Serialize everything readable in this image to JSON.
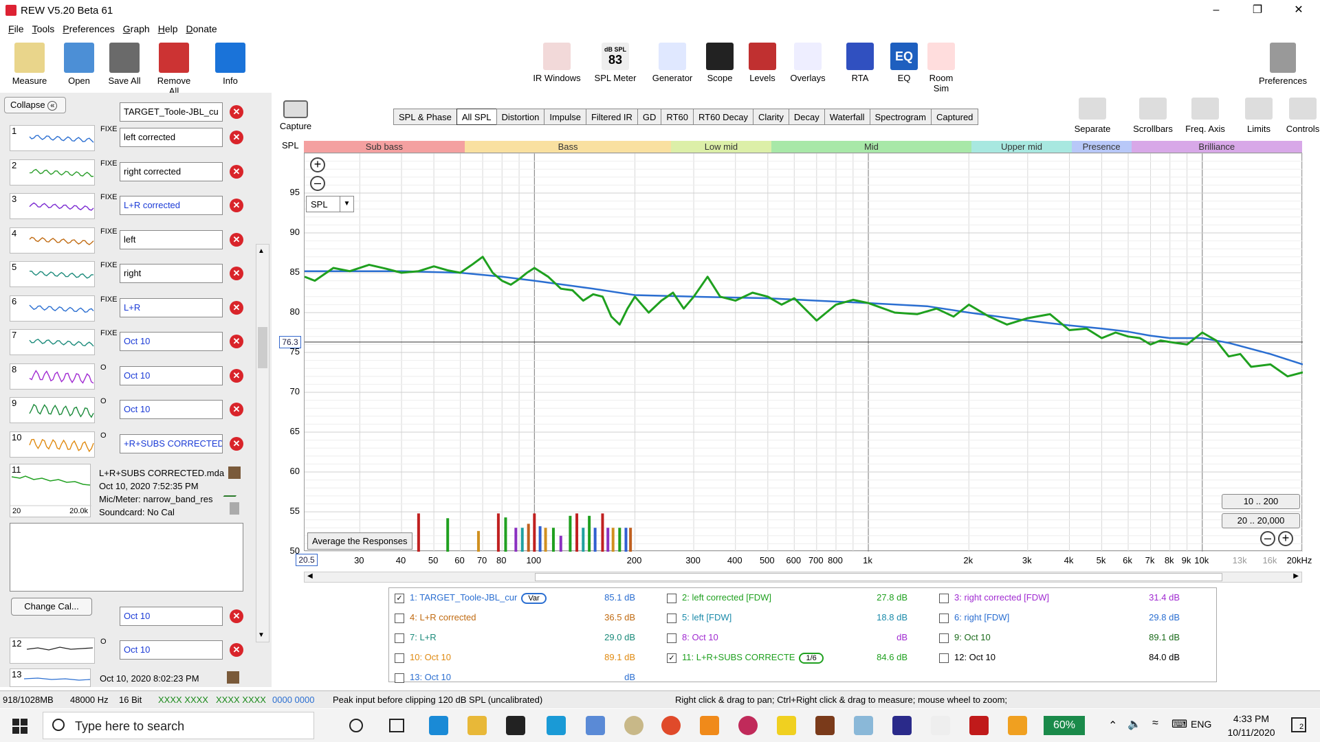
{
  "window": {
    "title": "REW V5.20 Beta 61"
  },
  "menu": [
    "File",
    "Tools",
    "Preferences",
    "Graph",
    "Help",
    "Donate"
  ],
  "toolbar_left": [
    {
      "label": "Measure",
      "color": "#e9d58b",
      "icon": "measure-icon"
    },
    {
      "label": "Open",
      "color": "#4c8fd6",
      "icon": "folder-open-icon"
    },
    {
      "label": "Save All",
      "color": "#6a6a6a",
      "icon": "save-icon"
    },
    {
      "label": "Remove All",
      "color": "#c33",
      "icon": "remove-all-icon"
    },
    {
      "label": "Info",
      "color": "#1a73d9",
      "icon": "info-icon"
    }
  ],
  "toolbar_mid": [
    {
      "label": "IR Windows",
      "color": "#f2d9d9",
      "icon": "ir-windows-icon"
    },
    {
      "label": "SPL Meter",
      "color": "#eee",
      "icon": "spl-meter-icon",
      "value": "83",
      "sub": "dB SPL"
    },
    {
      "label": "Generator",
      "color": "#e0e8ff",
      "icon": "generator-icon"
    },
    {
      "label": "Scope",
      "color": "#222",
      "icon": "scope-icon"
    },
    {
      "label": "Levels",
      "color": "#c03030",
      "icon": "levels-icon"
    },
    {
      "label": "Overlays",
      "color": "#eef",
      "icon": "overlays-icon"
    },
    {
      "label": "RTA",
      "color": "#3050c0",
      "icon": "rta-icon"
    },
    {
      "label": "EQ",
      "color": "#1e5fbf",
      "icon": "eq-icon",
      "value": "EQ"
    },
    {
      "label": "Room Sim",
      "color": "#fdd",
      "icon": "room-sim-icon"
    }
  ],
  "toolbar_right": {
    "label": "Preferences",
    "icon": "preferences-icon"
  },
  "left_panel": {
    "collapse": "Collapse",
    "top_field": "TARGET_Toole-JBL_cu",
    "fix_label": "FIXE",
    "measurements": [
      {
        "num": "1",
        "name": "left corrected",
        "color": "#2a6ed1",
        "fix": "FIXE"
      },
      {
        "num": "2",
        "name": "right corrected",
        "color": "#2a9d2a",
        "fix": "FIXE"
      },
      {
        "num": "3",
        "name": "L+R corrected",
        "color": "#7a2ad1",
        "fix": "FIXE"
      },
      {
        "num": "4",
        "name": "left",
        "color": "#c06a10",
        "fix": "FIXE"
      },
      {
        "num": "5",
        "name": "right",
        "color": "#1a8a7a",
        "fix": "FIXE"
      },
      {
        "num": "6",
        "name": "L+R",
        "color": "#2a6ed1",
        "fix": "FIXE"
      },
      {
        "num": "7",
        "name": "Oct 10",
        "color": "#1a8a7a",
        "fix": "FIXE"
      },
      {
        "num": "8",
        "name": "Oct 10",
        "color": "#a02ad1",
        "fix": "O"
      },
      {
        "num": "9",
        "name": "Oct 10",
        "color": "#1a8a3a",
        "fix": "O"
      },
      {
        "num": "10",
        "name": "+R+SUBS CORRECTED",
        "color": "#e08a10",
        "fix": "O"
      }
    ],
    "info": {
      "num": "11",
      "file": "L+R+SUBS CORRECTED.mda",
      "date": "Oct 10, 2020 7:52:35 PM",
      "mic": "Mic/Meter: narrow_band_res",
      "soundcard": "Soundcard: No Cal",
      "xmin": "20",
      "xmax": "20.0k"
    },
    "change_cal": "Change Cal...",
    "lower": [
      {
        "num": "",
        "name": "Oct 10"
      },
      {
        "num": "12",
        "name": "Oct 10",
        "fix": "O"
      }
    ],
    "last": {
      "num": "13",
      "date": "Oct 10, 2020 8:02:23 PM"
    }
  },
  "capture": "Capture",
  "graph_tabs": [
    "SPL & Phase",
    "All SPL",
    "Distortion",
    "Impulse",
    "Filtered IR",
    "GD",
    "RT60",
    "RT60 Decay",
    "Clarity",
    "Decay",
    "Waterfall",
    "Spectrogram",
    "Captured"
  ],
  "active_tab": "All SPL",
  "right_tools": [
    {
      "label": "Separate",
      "icon": "separate-icon"
    },
    {
      "label": "Scrollbars",
      "icon": "scrollbars-icon"
    },
    {
      "label": "Freq. Axis",
      "icon": "freq-axis-icon"
    },
    {
      "label": "Limits",
      "icon": "limits-icon"
    },
    {
      "label": "Controls",
      "icon": "controls-icon"
    }
  ],
  "bands": [
    {
      "name": "Sub bass",
      "color": "#f4a0a0",
      "w": 0.161
    },
    {
      "name": "Bass",
      "color": "#f9e0a0",
      "w": 0.207
    },
    {
      "name": "Low mid",
      "color": "#dcefa8",
      "w": 0.1
    },
    {
      "name": "Mid",
      "color": "#a8e8a8",
      "w": 0.201
    },
    {
      "name": "Upper mid",
      "color": "#a8e8e0",
      "w": 0.1
    },
    {
      "name": "Presence",
      "color": "#b8c8f8",
      "w": 0.06
    },
    {
      "name": "Brilliance",
      "color": "#d8a8e8",
      "w": 0.171
    }
  ],
  "plot": {
    "ylabel": "SPL",
    "mode": "SPL",
    "cursor_value": "76.3",
    "x_start": "20.5",
    "average_button": "Average the Responses",
    "range1": "10 .. 200",
    "range2": "20 .. 20,000"
  },
  "chart_data": {
    "type": "line",
    "xlabel": "",
    "ylabel": "SPL",
    "x_scale": "log",
    "xlim": [
      20.5,
      20000
    ],
    "ylim": [
      50,
      100
    ],
    "yticks": [
      50,
      55,
      60,
      65,
      70,
      75,
      80,
      85,
      90,
      95
    ],
    "xticks": [
      {
        "v": 30,
        "t": "30"
      },
      {
        "v": 40,
        "t": "40"
      },
      {
        "v": 50,
        "t": "50"
      },
      {
        "v": 60,
        "t": "60"
      },
      {
        "v": 70,
        "t": "70"
      },
      {
        "v": 80,
        "t": "80"
      },
      {
        "v": 100,
        "t": "100"
      },
      {
        "v": 200,
        "t": "200"
      },
      {
        "v": 300,
        "t": "300"
      },
      {
        "v": 400,
        "t": "400"
      },
      {
        "v": 500,
        "t": "500"
      },
      {
        "v": 600,
        "t": "600"
      },
      {
        "v": 700,
        "t": "700"
      },
      {
        "v": 800,
        "t": "800"
      },
      {
        "v": 1000,
        "t": "1k"
      },
      {
        "v": 2000,
        "t": "2k"
      },
      {
        "v": 3000,
        "t": "3k"
      },
      {
        "v": 4000,
        "t": "4k"
      },
      {
        "v": 5000,
        "t": "5k"
      },
      {
        "v": 6000,
        "t": "6k"
      },
      {
        "v": 7000,
        "t": "7k"
      },
      {
        "v": 8000,
        "t": "8k"
      },
      {
        "v": 9000,
        "t": "9k"
      },
      {
        "v": 10000,
        "t": "10k"
      },
      {
        "v": 13000,
        "t": "13k"
      },
      {
        "v": 16000,
        "t": "16k"
      },
      {
        "v": 20000,
        "t": "20kHz"
      }
    ],
    "series": [
      {
        "name": "TARGET_Toole-JBL_cur",
        "color": "#2a6ed1",
        "x": [
          20.5,
          40,
          60,
          80,
          100,
          150,
          200,
          300,
          500,
          700,
          1000,
          1500,
          2000,
          3000,
          4000,
          5000,
          6000,
          7000,
          8000,
          10000,
          12000,
          16000,
          20000
        ],
        "y": [
          85.2,
          85.2,
          85.0,
          84.5,
          84,
          83,
          82.2,
          82,
          81.8,
          81.5,
          81.2,
          80.8,
          80,
          79,
          78.4,
          78,
          77.6,
          77.1,
          76.8,
          76.8,
          76.2,
          74.8,
          73.5
        ]
      },
      {
        "name": "11: L+R+SUBS CORRECTE",
        "color": "#1fa01f",
        "x": [
          20.5,
          22,
          25,
          28,
          32,
          36,
          40,
          45,
          50,
          55,
          60,
          65,
          70,
          75,
          80,
          85,
          90,
          95,
          100,
          110,
          120,
          130,
          140,
          150,
          160,
          170,
          180,
          190,
          200,
          220,
          240,
          260,
          280,
          300,
          330,
          360,
          400,
          450,
          500,
          550,
          600,
          700,
          800,
          900,
          1000,
          1200,
          1400,
          1600,
          1800,
          2000,
          2300,
          2600,
          3000,
          3500,
          4000,
          4500,
          5000,
          5500,
          6000,
          6500,
          7000,
          7500,
          8000,
          9000,
          10000,
          11000,
          12000,
          13000,
          14000,
          16000,
          18000,
          20000
        ],
        "y": [
          84.5,
          84,
          85.6,
          85.2,
          86,
          85.5,
          85,
          85.2,
          85.8,
          85.3,
          85,
          86,
          87,
          85,
          84,
          83.5,
          84.2,
          85,
          85.6,
          84.5,
          83,
          82.8,
          81.5,
          82.3,
          82,
          79.5,
          78.5,
          80.5,
          82,
          80,
          81.5,
          82.5,
          80.5,
          82,
          84.5,
          82,
          81.5,
          82.5,
          82,
          81,
          81.8,
          79,
          81,
          81.6,
          81.2,
          80,
          79.8,
          80.5,
          79.5,
          81,
          79.5,
          78.5,
          79.3,
          79.8,
          77.8,
          78,
          76.8,
          77.5,
          77,
          76.8,
          76,
          76.5,
          76.3,
          76,
          77.5,
          76.5,
          74.5,
          74.8,
          73.2,
          73.5,
          72,
          72.5
        ]
      }
    ],
    "bars": [
      {
        "x": 45,
        "y": 54.8,
        "c": "#c02020"
      },
      {
        "x": 55,
        "y": 54.2,
        "c": "#20a020"
      },
      {
        "x": 68,
        "y": 52.6,
        "c": "#d09020"
      },
      {
        "x": 78,
        "y": 54.8,
        "c": "#c02020"
      },
      {
        "x": 82,
        "y": 54.3,
        "c": "#20a020"
      },
      {
        "x": 88,
        "y": 53,
        "c": "#8a30c0"
      },
      {
        "x": 92,
        "y": 53,
        "c": "#20a0a0"
      },
      {
        "x": 96,
        "y": 53.5,
        "c": "#c06020"
      },
      {
        "x": 100,
        "y": 54.8,
        "c": "#c02020"
      },
      {
        "x": 104,
        "y": 53.2,
        "c": "#3060d0"
      },
      {
        "x": 108,
        "y": 53,
        "c": "#d09020"
      },
      {
        "x": 114,
        "y": 53,
        "c": "#20a020"
      },
      {
        "x": 120,
        "y": 52,
        "c": "#8a30c0"
      },
      {
        "x": 128,
        "y": 54.5,
        "c": "#20a020"
      },
      {
        "x": 134,
        "y": 54.8,
        "c": "#c02020"
      },
      {
        "x": 140,
        "y": 53,
        "c": "#20a0a0"
      },
      {
        "x": 146,
        "y": 54.5,
        "c": "#20a020"
      },
      {
        "x": 152,
        "y": 53,
        "c": "#3060d0"
      },
      {
        "x": 160,
        "y": 54.8,
        "c": "#c02020"
      },
      {
        "x": 166,
        "y": 53,
        "c": "#8a30c0"
      },
      {
        "x": 172,
        "y": 53,
        "c": "#d09020"
      },
      {
        "x": 180,
        "y": 53,
        "c": "#20a020"
      },
      {
        "x": 188,
        "y": 53,
        "c": "#3060d0"
      },
      {
        "x": 194,
        "y": 53,
        "c": "#c06020"
      }
    ]
  },
  "legend": [
    {
      "label": "1: TARGET_Toole-JBL_cur",
      "value": "85.1 dB",
      "color": "#2a6ed1",
      "checked": true,
      "tag": "Var"
    },
    {
      "label": "2: left corrected [FDW]",
      "value": "27.8 dB",
      "color": "#1fa01f",
      "checked": false
    },
    {
      "label": "3: right corrected [FDW]",
      "value": "31.4 dB",
      "color": "#a02ad1",
      "checked": false
    },
    {
      "label": "4: L+R corrected",
      "value": "36.5 dB",
      "color": "#c06a10",
      "checked": false
    },
    {
      "label": "5: left [FDW]",
      "value": "18.8 dB",
      "color": "#1a8aaa",
      "checked": false
    },
    {
      "label": "6: right [FDW]",
      "value": "29.8 dB",
      "color": "#2a6ed1",
      "checked": false
    },
    {
      "label": "7: L+R",
      "value": "29.0 dB",
      "color": "#1a8a7a",
      "checked": false
    },
    {
      "label": "8: Oct 10",
      "value": "dB",
      "color": "#a02ad1",
      "checked": false
    },
    {
      "label": "9: Oct 10",
      "value": "89.1 dB",
      "color": "#1a6a1a",
      "checked": false
    },
    {
      "label": "10: Oct 10",
      "value": "89.1 dB",
      "color": "#e08a10",
      "checked": false
    },
    {
      "label": "11: L+R+SUBS CORRECTE",
      "value": "84.6 dB",
      "color": "#1fa01f",
      "checked": true,
      "tag": "1/6"
    },
    {
      "label": "12: Oct 10",
      "value": "84.0 dB",
      "color": "#000",
      "checked": false
    },
    {
      "label": "13: Oct 10",
      "value": "dB",
      "color": "#2a6ed1",
      "checked": false
    }
  ],
  "status": {
    "mem": "918/1028MB",
    "rate": "48000 Hz",
    "bits": "16 Bit",
    "levels1": "XXXX XXXX",
    "levels2": "XXXX XXXX",
    "levels3": "0000 0000",
    "peak": "Peak input before clipping 120 dB SPL (uncalibrated)",
    "hint": "Right click & drag to pan; Ctrl+Right click & drag to measure; mouse wheel to zoom;"
  },
  "taskbar": {
    "search": "Type here to search",
    "battery": "60%",
    "lang": "ENG",
    "time": "4:33 PM",
    "date": "10/11/2020",
    "notif": "2"
  }
}
